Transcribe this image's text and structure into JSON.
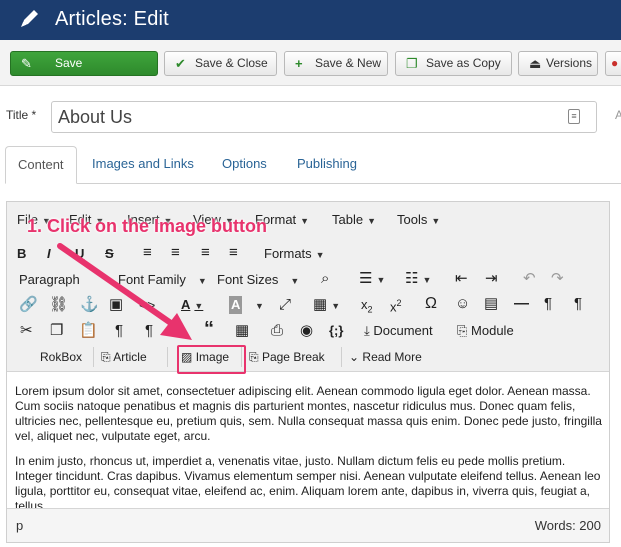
{
  "header": {
    "title": "Articles: Edit",
    "icon": "pencil-icon"
  },
  "toolbar": {
    "save": "Save",
    "save_close": "Save & Close",
    "save_new": "Save & New",
    "save_copy": "Save as Copy",
    "versions": "Versions"
  },
  "title_field": {
    "label": "Title *",
    "value": "About Us"
  },
  "tabs": [
    "Content",
    "Images and Links",
    "Options",
    "Publishing"
  ],
  "editor": {
    "menu": [
      "File",
      "Edit",
      "Insert",
      "View",
      "Format",
      "Table",
      "Tools"
    ],
    "formats_label": "Formats",
    "paragraph_label": "Paragraph",
    "font_family_label": "Font Family",
    "font_sizes_label": "Font Sizes",
    "document_button": "Document",
    "module_button": "Module",
    "rokbox_button": "RokBox",
    "article_button": "Article",
    "image_button": "Image",
    "page_break_button": "Page Break",
    "read_more_button": "Read More",
    "content": [
      "Lorem ipsum dolor sit amet, consectetuer adipiscing elit. Aenean commodo ligula eget dolor. Aenean massa. Cum sociis natoque penatibus et magnis dis parturient montes, nascetur ridiculus mus. Donec quam felis, ultricies nec, pellentesque eu, pretium quis, sem. Nulla consequat massa quis enim. Donec pede justo, fringilla vel, aliquet nec, vulputate eget, arcu.",
      "In enim justo, rhoncus ut, imperdiet a, venenatis vitae, justo. Nullam dictum felis eu pede mollis pretium. Integer tincidunt. Cras dapibus. Vivamus elementum semper nisi. Aenean vulputate eleifend tellus. Aenean leo ligula, porttitor eu, consequat vitae, eleifend ac, enim. Aliquam lorem ante, dapibus in, viverra quis, feugiat a, tellus."
    ],
    "status_path": "p",
    "word_count": "Words: 200"
  },
  "annotation": {
    "text": "1. Click on the Image button",
    "color": "#e8336d"
  }
}
